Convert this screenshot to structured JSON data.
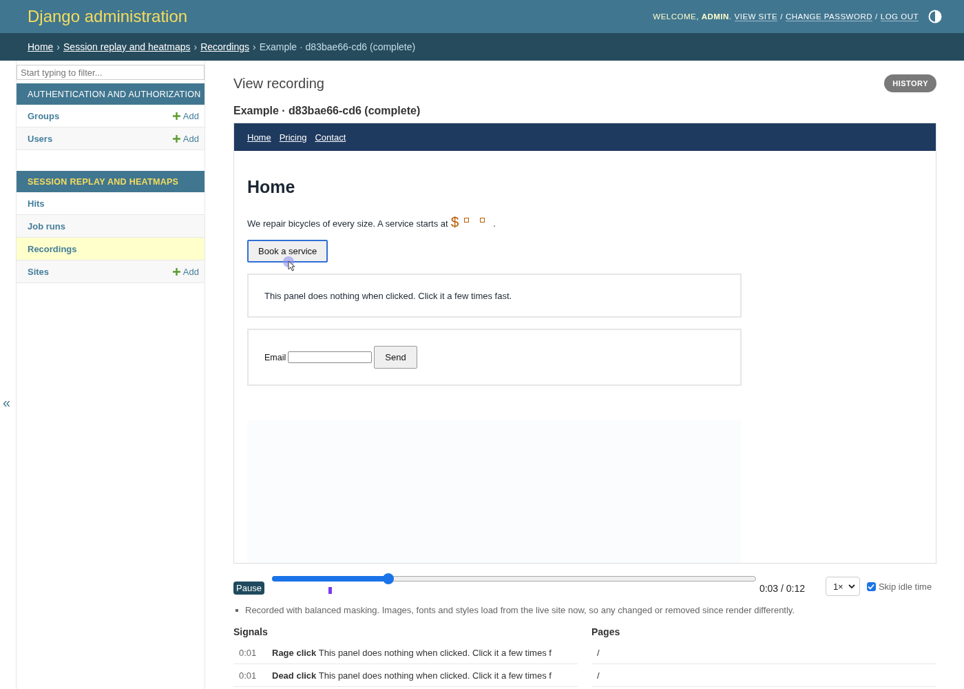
{
  "header": {
    "title": "Django administration",
    "welcome": "WELCOME, ",
    "user": "ADMIN",
    "welcome_end": ".",
    "links": [
      "VIEW SITE",
      "CHANGE PASSWORD",
      "LOG OUT"
    ],
    "separator": "/"
  },
  "breadcrumbs": {
    "separator": "›",
    "items": [
      {
        "label": "Home",
        "link": true
      },
      {
        "label": "Session replay and heatmaps",
        "link": true
      },
      {
        "label": "Recordings",
        "link": true
      },
      {
        "label": "Example · d83bae66-cd6 (complete)",
        "link": false
      }
    ]
  },
  "sidebar": {
    "filter_placeholder": "Start typing to filter...",
    "collapse": "«",
    "sections": [
      {
        "title": "AUTHENTICATION AND AUTHORIZATION",
        "selected": false,
        "items": [
          {
            "label": "Groups",
            "add": "Add",
            "selected": false
          },
          {
            "label": "Users",
            "add": "Add",
            "selected": false
          }
        ]
      },
      {
        "title": "SESSION REPLAY AND HEATMAPS",
        "selected": true,
        "items": [
          {
            "label": "Hits",
            "selected": false
          },
          {
            "label": "Job runs",
            "selected": false
          },
          {
            "label": "Recordings",
            "selected": true
          },
          {
            "label": "Sites",
            "add": "Add",
            "selected": false
          }
        ]
      }
    ]
  },
  "content": {
    "title": "View recording",
    "history": "HISTORY",
    "subtitle": "Example · d83bae66-cd6 (complete)"
  },
  "replay": {
    "nav": [
      "Home",
      "Pricing",
      "Contact"
    ],
    "heading": "Home",
    "text": "We repair bicycles of every size. A service starts at",
    "price_symbol": "$",
    "price_end": ".",
    "button": "Book a service",
    "panel_text": "This panel does nothing when clicked. Click it a few times fast.",
    "email_label": "Email",
    "send": "Send"
  },
  "player": {
    "pause": "Pause",
    "level": 0.24,
    "time": "0:03 / 0:12",
    "speed": "1×",
    "skip_idle": {
      "label": "Skip idle time",
      "checked": true
    }
  },
  "note": "Recorded with balanced masking. Images, fonts and styles load from the live site now, so any changed or removed since render differently.",
  "signals": {
    "heading": "Signals",
    "rows": [
      {
        "time": "0:01",
        "text": "**Rage click** This panel does nothing when clicked. Click it a few times f"
      },
      {
        "time": "0:01",
        "text": "**Dead click** This panel does nothing when clicked. Click it a few times f"
      }
    ]
  },
  "pages": {
    "heading": "Pages",
    "rows": [
      "/",
      "/"
    ]
  }
}
